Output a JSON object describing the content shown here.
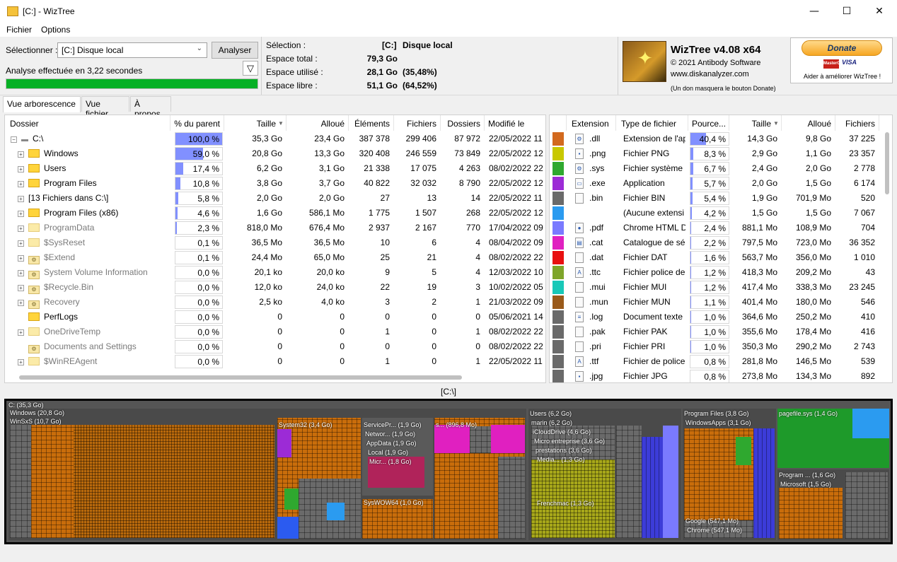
{
  "window": {
    "title": "[C:]  - WizTree",
    "minimize": "—",
    "maximize": "☐",
    "close": "✕"
  },
  "menu": {
    "file": "Fichier",
    "options": "Options"
  },
  "toolbar": {
    "select_label": "Sélectionner :",
    "drive": "[C:] Disque local",
    "analyze": "Analyser",
    "status": "Analyse effectuée en 3,22 secondes",
    "progress": 1.0
  },
  "summary": {
    "selection_label": "Sélection :",
    "selection_drive": "[C:]",
    "selection_name": "Disque local",
    "total_label": "Espace total :",
    "total": "79,3 Go",
    "used_label": "Espace utilisé :",
    "used": "28,1 Go",
    "used_pct": "(35,48%)",
    "free_label": "Espace libre :",
    "free": "51,1 Go",
    "free_pct": "(64,52%)"
  },
  "about": {
    "app": "WizTree v4.08 x64",
    "copyright": "© 2021 Antibody Software",
    "website": "www.diskanalyzer.com",
    "donate_note": "(Un don masquera le bouton Donate)",
    "donate": "Donate",
    "card_mc": "MasterCard",
    "card_visa": "VISA",
    "help": "Aider à améliorer WizTree !"
  },
  "tabs": [
    "Vue arborescence",
    "Vue fichier",
    "À propos"
  ],
  "tree": {
    "headers": [
      "Dossier",
      "% du parent",
      "Taille",
      "Alloué",
      "Éléments",
      "Fichiers",
      "Dossiers",
      "Modifié le"
    ],
    "rows": [
      {
        "name": "C:\\",
        "pct": "100,0 %",
        "pv": 1.0,
        "size": "35,3 Go",
        "alloc": "23,4 Go",
        "items": "387 378",
        "files": "299 406",
        "dirs": "87 972",
        "date": "22/05/2022 11",
        "kind": "drive",
        "exp": "⊟",
        "level": 0
      },
      {
        "name": "Windows",
        "pct": "59,0 %",
        "pv": 0.59,
        "size": "20,8 Go",
        "alloc": "13,3 Go",
        "items": "320 408",
        "files": "246 559",
        "dirs": "73 849",
        "date": "22/05/2022 12",
        "kind": "folder",
        "exp": "⊞",
        "level": 1
      },
      {
        "name": "Users",
        "pct": "17,4 %",
        "pv": 0.174,
        "size": "6,2 Go",
        "alloc": "3,1 Go",
        "items": "21 338",
        "files": "17 075",
        "dirs": "4 263",
        "date": "08/02/2022 22",
        "kind": "folder",
        "exp": "⊞",
        "level": 1
      },
      {
        "name": "Program Files",
        "pct": "10,8 %",
        "pv": 0.108,
        "size": "3,8 Go",
        "alloc": "3,7 Go",
        "items": "40 822",
        "files": "32 032",
        "dirs": "8 790",
        "date": "22/05/2022 12",
        "kind": "folder",
        "exp": "⊞",
        "level": 1
      },
      {
        "name": "[13 Fichiers dans C:\\]",
        "pct": "5,8 %",
        "pv": 0.058,
        "size": "2,0 Go",
        "alloc": "2,0 Go",
        "items": "27",
        "files": "13",
        "dirs": "14",
        "date": "22/05/2022 11",
        "kind": "none",
        "exp": "⊞",
        "level": 1
      },
      {
        "name": "Program Files (x86)",
        "pct": "4,6 %",
        "pv": 0.046,
        "size": "1,6 Go",
        "alloc": "586,1 Mo",
        "items": "1 775",
        "files": "1 507",
        "dirs": "268",
        "date": "22/05/2022 12",
        "kind": "folder",
        "exp": "⊞",
        "level": 1
      },
      {
        "name": "ProgramData",
        "pct": "2,3 %",
        "pv": 0.023,
        "size": "818,0 Mo",
        "alloc": "676,4 Mo",
        "items": "2 937",
        "files": "2 167",
        "dirs": "770",
        "date": "17/04/2022 09",
        "kind": "gray",
        "exp": "⊞",
        "level": 1
      },
      {
        "name": "$SysReset",
        "pct": "0,1 %",
        "pv": 0.001,
        "size": "36,5 Mo",
        "alloc": "36,5 Mo",
        "items": "10",
        "files": "6",
        "dirs": "4",
        "date": "08/04/2022 09",
        "kind": "gray",
        "exp": "⊞",
        "level": 1
      },
      {
        "name": "$Extend",
        "pct": "0,1 %",
        "pv": 0.001,
        "size": "24,4 Mo",
        "alloc": "65,0 Mo",
        "items": "25",
        "files": "21",
        "dirs": "4",
        "date": "08/02/2022 22",
        "kind": "gear",
        "exp": "⊞",
        "level": 1
      },
      {
        "name": "System Volume Information",
        "pct": "0,0 %",
        "pv": 0,
        "size": "20,1 ko",
        "alloc": "20,0 ko",
        "items": "9",
        "files": "5",
        "dirs": "4",
        "date": "12/03/2022 10",
        "kind": "gear",
        "exp": "⊞",
        "level": 1
      },
      {
        "name": "$Recycle.Bin",
        "pct": "0,0 %",
        "pv": 0,
        "size": "12,0 ko",
        "alloc": "24,0 ko",
        "items": "22",
        "files": "19",
        "dirs": "3",
        "date": "10/02/2022 05",
        "kind": "gear",
        "exp": "⊞",
        "level": 1
      },
      {
        "name": "Recovery",
        "pct": "0,0 %",
        "pv": 0,
        "size": "2,5 ko",
        "alloc": "4,0 ko",
        "items": "3",
        "files": "2",
        "dirs": "1",
        "date": "21/03/2022 09",
        "kind": "gear",
        "exp": "⊞",
        "level": 1
      },
      {
        "name": "PerfLogs",
        "pct": "0,0 %",
        "pv": 0,
        "size": "0",
        "alloc": "0",
        "items": "0",
        "files": "0",
        "dirs": "0",
        "date": "05/06/2021 14",
        "kind": "folder",
        "exp": "",
        "level": 1
      },
      {
        "name": "OneDriveTemp",
        "pct": "0,0 %",
        "pv": 0,
        "size": "0",
        "alloc": "0",
        "items": "1",
        "files": "0",
        "dirs": "1",
        "date": "08/02/2022 22",
        "kind": "gray",
        "exp": "⊞",
        "level": 1
      },
      {
        "name": "Documents and Settings",
        "pct": "0,0 %",
        "pv": 0,
        "size": "0",
        "alloc": "0",
        "items": "0",
        "files": "0",
        "dirs": "0",
        "date": "08/02/2022 22",
        "kind": "gear",
        "exp": "",
        "level": 1
      },
      {
        "name": "$WinREAgent",
        "pct": "0,0 %",
        "pv": 0,
        "size": "0",
        "alloc": "0",
        "items": "1",
        "files": "0",
        "dirs": "1",
        "date": "22/05/2022 11",
        "kind": "gray",
        "exp": "⊞",
        "level": 1
      }
    ]
  },
  "extensions": {
    "headers": [
      "Extension",
      "Type de fichier",
      "Pource...",
      "Taille",
      "Alloué",
      "Fichiers"
    ],
    "rows": [
      {
        "color": "#d2691e",
        "ext": ".dll",
        "type": "Extension de l'ap",
        "pct": "40,4 %",
        "pv": 0.404,
        "size": "14,3 Go",
        "alloc": "9,8 Go",
        "files": "37 225",
        "icon": "⚙"
      },
      {
        "color": "#c8c800",
        "ext": ".png",
        "type": "Fichier PNG",
        "pct": "8,3 %",
        "pv": 0.083,
        "size": "2,9 Go",
        "alloc": "1,1 Go",
        "files": "23 357",
        "icon": "▪"
      },
      {
        "color": "#2fa82f",
        "ext": ".sys",
        "type": "Fichier système",
        "pct": "6,7 %",
        "pv": 0.067,
        "size": "2,4 Go",
        "alloc": "2,0 Go",
        "files": "2 778",
        "icon": "⚙"
      },
      {
        "color": "#9c2bd6",
        "ext": ".exe",
        "type": "Application",
        "pct": "5,7 %",
        "pv": 0.057,
        "size": "2,0 Go",
        "alloc": "1,5 Go",
        "files": "6 174",
        "icon": "▭"
      },
      {
        "color": "#6a6a6a",
        "ext": ".bin",
        "type": "Fichier BIN",
        "pct": "5,4 %",
        "pv": 0.054,
        "size": "1,9 Go",
        "alloc": "701,9 Mo",
        "files": "520",
        "icon": ""
      },
      {
        "color": "#2b9bf0",
        "ext": "",
        "type": "(Aucune extensi",
        "pct": "4,2 %",
        "pv": 0.042,
        "size": "1,5 Go",
        "alloc": "1,5 Go",
        "files": "7 067",
        "icon": ""
      },
      {
        "color": "#7a7aff",
        "ext": ".pdf",
        "type": "Chrome HTML D",
        "pct": "2,4 %",
        "pv": 0.024,
        "size": "881,1 Mo",
        "alloc": "108,9 Mo",
        "files": "704",
        "icon": "●"
      },
      {
        "color": "#e020c0",
        "ext": ".cat",
        "type": "Catalogue de séc",
        "pct": "2,2 %",
        "pv": 0.022,
        "size": "797,5 Mo",
        "alloc": "723,0 Mo",
        "files": "36 352",
        "icon": "▤"
      },
      {
        "color": "#e81010",
        "ext": ".dat",
        "type": "Fichier DAT",
        "pct": "1,6 %",
        "pv": 0.016,
        "size": "563,7 Mo",
        "alloc": "356,0 Mo",
        "files": "1 010",
        "icon": ""
      },
      {
        "color": "#7fa52a",
        "ext": ".ttc",
        "type": "Fichier police de",
        "pct": "1,2 %",
        "pv": 0.012,
        "size": "418,3 Mo",
        "alloc": "209,2 Mo",
        "files": "43",
        "icon": "A"
      },
      {
        "color": "#18c8b8",
        "ext": ".mui",
        "type": "Fichier MUI",
        "pct": "1,2 %",
        "pv": 0.012,
        "size": "417,4 Mo",
        "alloc": "338,3 Mo",
        "files": "23 245",
        "icon": ""
      },
      {
        "color": "#9a5a1a",
        "ext": ".mun",
        "type": "Fichier MUN",
        "pct": "1,1 %",
        "pv": 0.011,
        "size": "401,4 Mo",
        "alloc": "180,0 Mo",
        "files": "546",
        "icon": ""
      },
      {
        "color": "#6a6a6a",
        "ext": ".log",
        "type": "Document texte",
        "pct": "1,0 %",
        "pv": 0.01,
        "size": "364,6 Mo",
        "alloc": "250,2 Mo",
        "files": "410",
        "icon": "≡"
      },
      {
        "color": "#6a6a6a",
        "ext": ".pak",
        "type": "Fichier PAK",
        "pct": "1,0 %",
        "pv": 0.01,
        "size": "355,6 Mo",
        "alloc": "178,4 Mo",
        "files": "416",
        "icon": ""
      },
      {
        "color": "#6a6a6a",
        "ext": ".pri",
        "type": "Fichier PRI",
        "pct": "1,0 %",
        "pv": 0.01,
        "size": "350,3 Mo",
        "alloc": "290,2 Mo",
        "files": "2 743",
        "icon": ""
      },
      {
        "color": "#6a6a6a",
        "ext": ".ttf",
        "type": "Fichier de police",
        "pct": "0,8 %",
        "pv": 0.008,
        "size": "281,8 Mo",
        "alloc": "146,5 Mo",
        "files": "539",
        "icon": "A"
      },
      {
        "color": "#6a6a6a",
        "ext": ".jpg",
        "type": "Fichier JPG",
        "pct": "0,8 %",
        "pv": 0.008,
        "size": "273,8 Mo",
        "alloc": "134,3 Mo",
        "files": "892",
        "icon": "▪"
      }
    ]
  },
  "path": "[C:\\]",
  "treemap": {
    "root": "C: (35,3 Go)",
    "windows": "Windows (20,8 Go)",
    "winsxs": "WinSxS (10,7 Go)",
    "system32": "System32 (3,4 Go)",
    "servicepr": "ServicePr... (1,9 Go)",
    "network": "Networ... (1,9 Go)",
    "appdata": "AppData (1,9 Go)",
    "local": "Local (1,9 Go)",
    "micr": "Micr... (1,8 Go)",
    "s": "s... (896,8 Mo)",
    "syswow64": "SysWOW64 (1,0 Go)",
    "users": "Users (6,2 Go)",
    "marin": "marin (6,2 Go)",
    "icloud": "iCloudDrive (4,6 Go)",
    "micro_ent": "Micro entreprise (3,6 Go)",
    "prestations": "prestations (3,6 Go)",
    "media": "Media... (1,3 Go)",
    "frenchmac": "Frenchmac (1,3 Go)",
    "programfiles": "Program Files (3,8 Go)",
    "windowsapps": "WindowsApps (3,1 Go)",
    "google": "Google (547,1 Mo)",
    "chrome": "Chrome (547,1 Mo)",
    "pagefile": "pagefile.sys (1,4 Go)",
    "program86": "Program ... (1,6 Go)",
    "microsoft": "Microsoft (1,5 Go)"
  }
}
